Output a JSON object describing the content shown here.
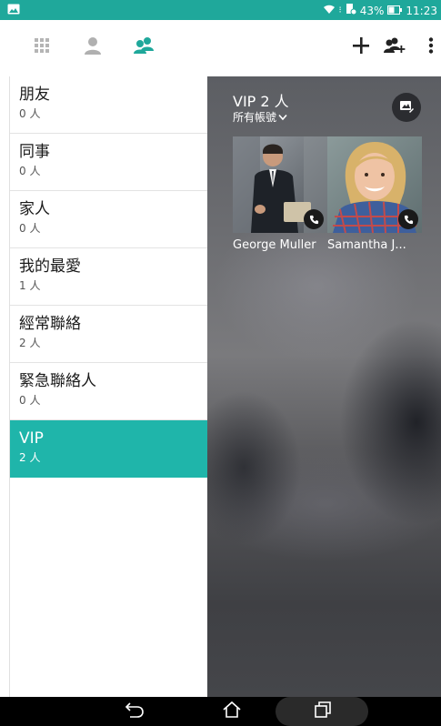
{
  "status_bar": {
    "battery": "43%",
    "time": "11:23",
    "color": "#1fa89b"
  },
  "toolbar": {
    "tabs": [
      {
        "icon": "grid-icon"
      },
      {
        "icon": "person-icon"
      },
      {
        "icon": "groups-icon",
        "active": true
      }
    ],
    "actions": [
      {
        "icon": "add-icon"
      },
      {
        "icon": "add-group-icon"
      },
      {
        "icon": "more-vert-icon"
      }
    ]
  },
  "groups": [
    {
      "name": "朋友",
      "count": "0 人"
    },
    {
      "name": "同事",
      "count": "0 人"
    },
    {
      "name": "家人",
      "count": "0 人"
    },
    {
      "name": "我的最愛",
      "count": "1 人"
    },
    {
      "name": "經常聯絡",
      "count": "2 人"
    },
    {
      "name": "緊急聯絡人",
      "count": "0 人"
    },
    {
      "name": "VIP",
      "count": "2 人",
      "selected": true
    }
  ],
  "detail": {
    "title": "VIP 2 人",
    "account_filter": "所有帳號",
    "contacts": [
      {
        "name": "George Muller"
      },
      {
        "name": "Samantha J..."
      }
    ]
  },
  "accent_color": "#1fb5aa"
}
